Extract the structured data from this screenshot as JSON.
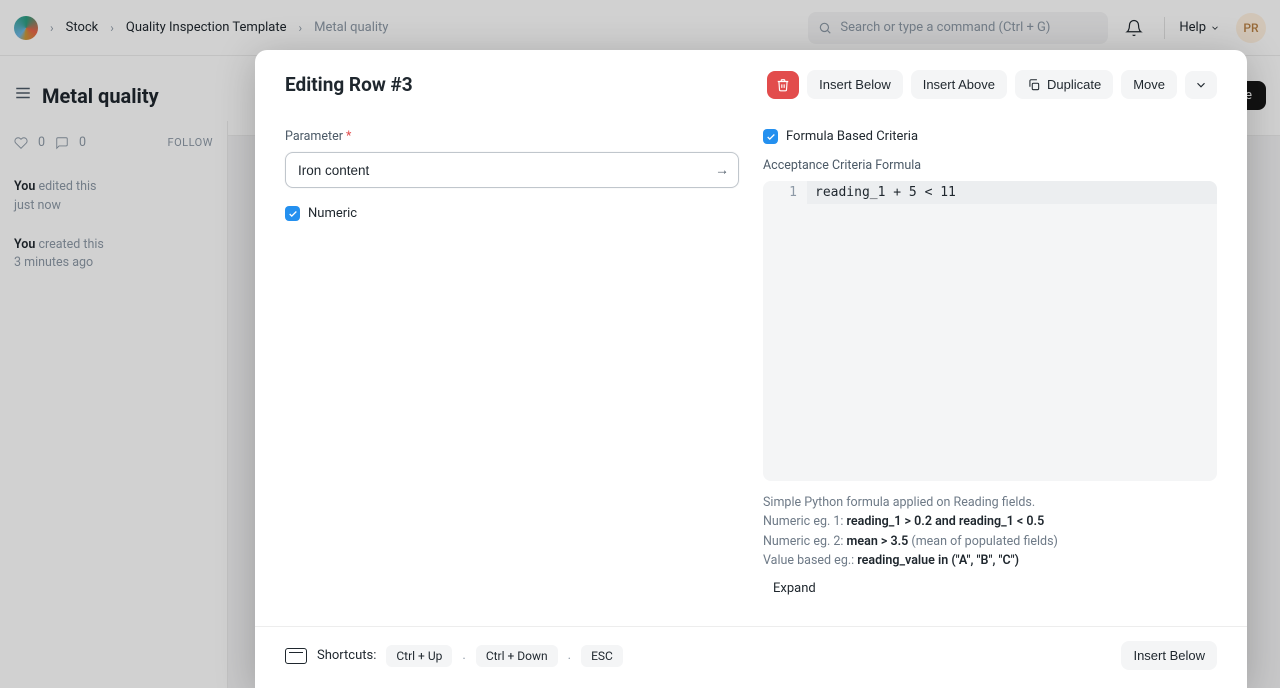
{
  "navbar": {
    "breadcrumb": [
      "Stock",
      "Quality Inspection Template",
      "Metal quality"
    ],
    "search_placeholder": "Search or type a command (Ctrl + G)",
    "help_label": "Help",
    "avatar_initials": "PR"
  },
  "page": {
    "title": "Metal quality",
    "save_label": "Save"
  },
  "sidebar": {
    "like_count": "0",
    "comment_count": "0",
    "follow_label": "FOLLOW",
    "feed": [
      {
        "who": "You",
        "action": "edited this",
        "time": "just now"
      },
      {
        "who": "You",
        "action": "created this",
        "time": "3 minutes ago"
      }
    ]
  },
  "modal": {
    "title": "Editing Row #3",
    "buttons": {
      "insert_below": "Insert Below",
      "insert_above": "Insert Above",
      "duplicate": "Duplicate",
      "move": "Move"
    },
    "left": {
      "parameter_label": "Parameter",
      "parameter_value": "Iron content",
      "numeric_label": "Numeric"
    },
    "right": {
      "fbc_label": "Formula Based Criteria",
      "acf_label": "Acceptance Criteria Formula",
      "formula_line_no": "1",
      "formula_code": "reading_1 + 5 < 11",
      "help_line1": "Simple Python formula applied on Reading fields.",
      "help_line2a": "Numeric eg. 1: ",
      "help_line2b": "reading_1 > 0.2 and reading_1 < 0.5",
      "help_line3a": "Numeric eg. 2: ",
      "help_line3b": "mean > 3.5",
      "help_line3c": " (mean of populated fields)",
      "help_line4a": "Value based eg.: ",
      "help_line4b": "reading_value in (\"A\", \"B\", \"C\")",
      "expand_label": "Expand"
    },
    "footer": {
      "shortcuts_label": "Shortcuts:",
      "k1": "Ctrl + Up",
      "k2": "Ctrl + Down",
      "k3": "ESC",
      "insert_below": "Insert Below"
    }
  }
}
